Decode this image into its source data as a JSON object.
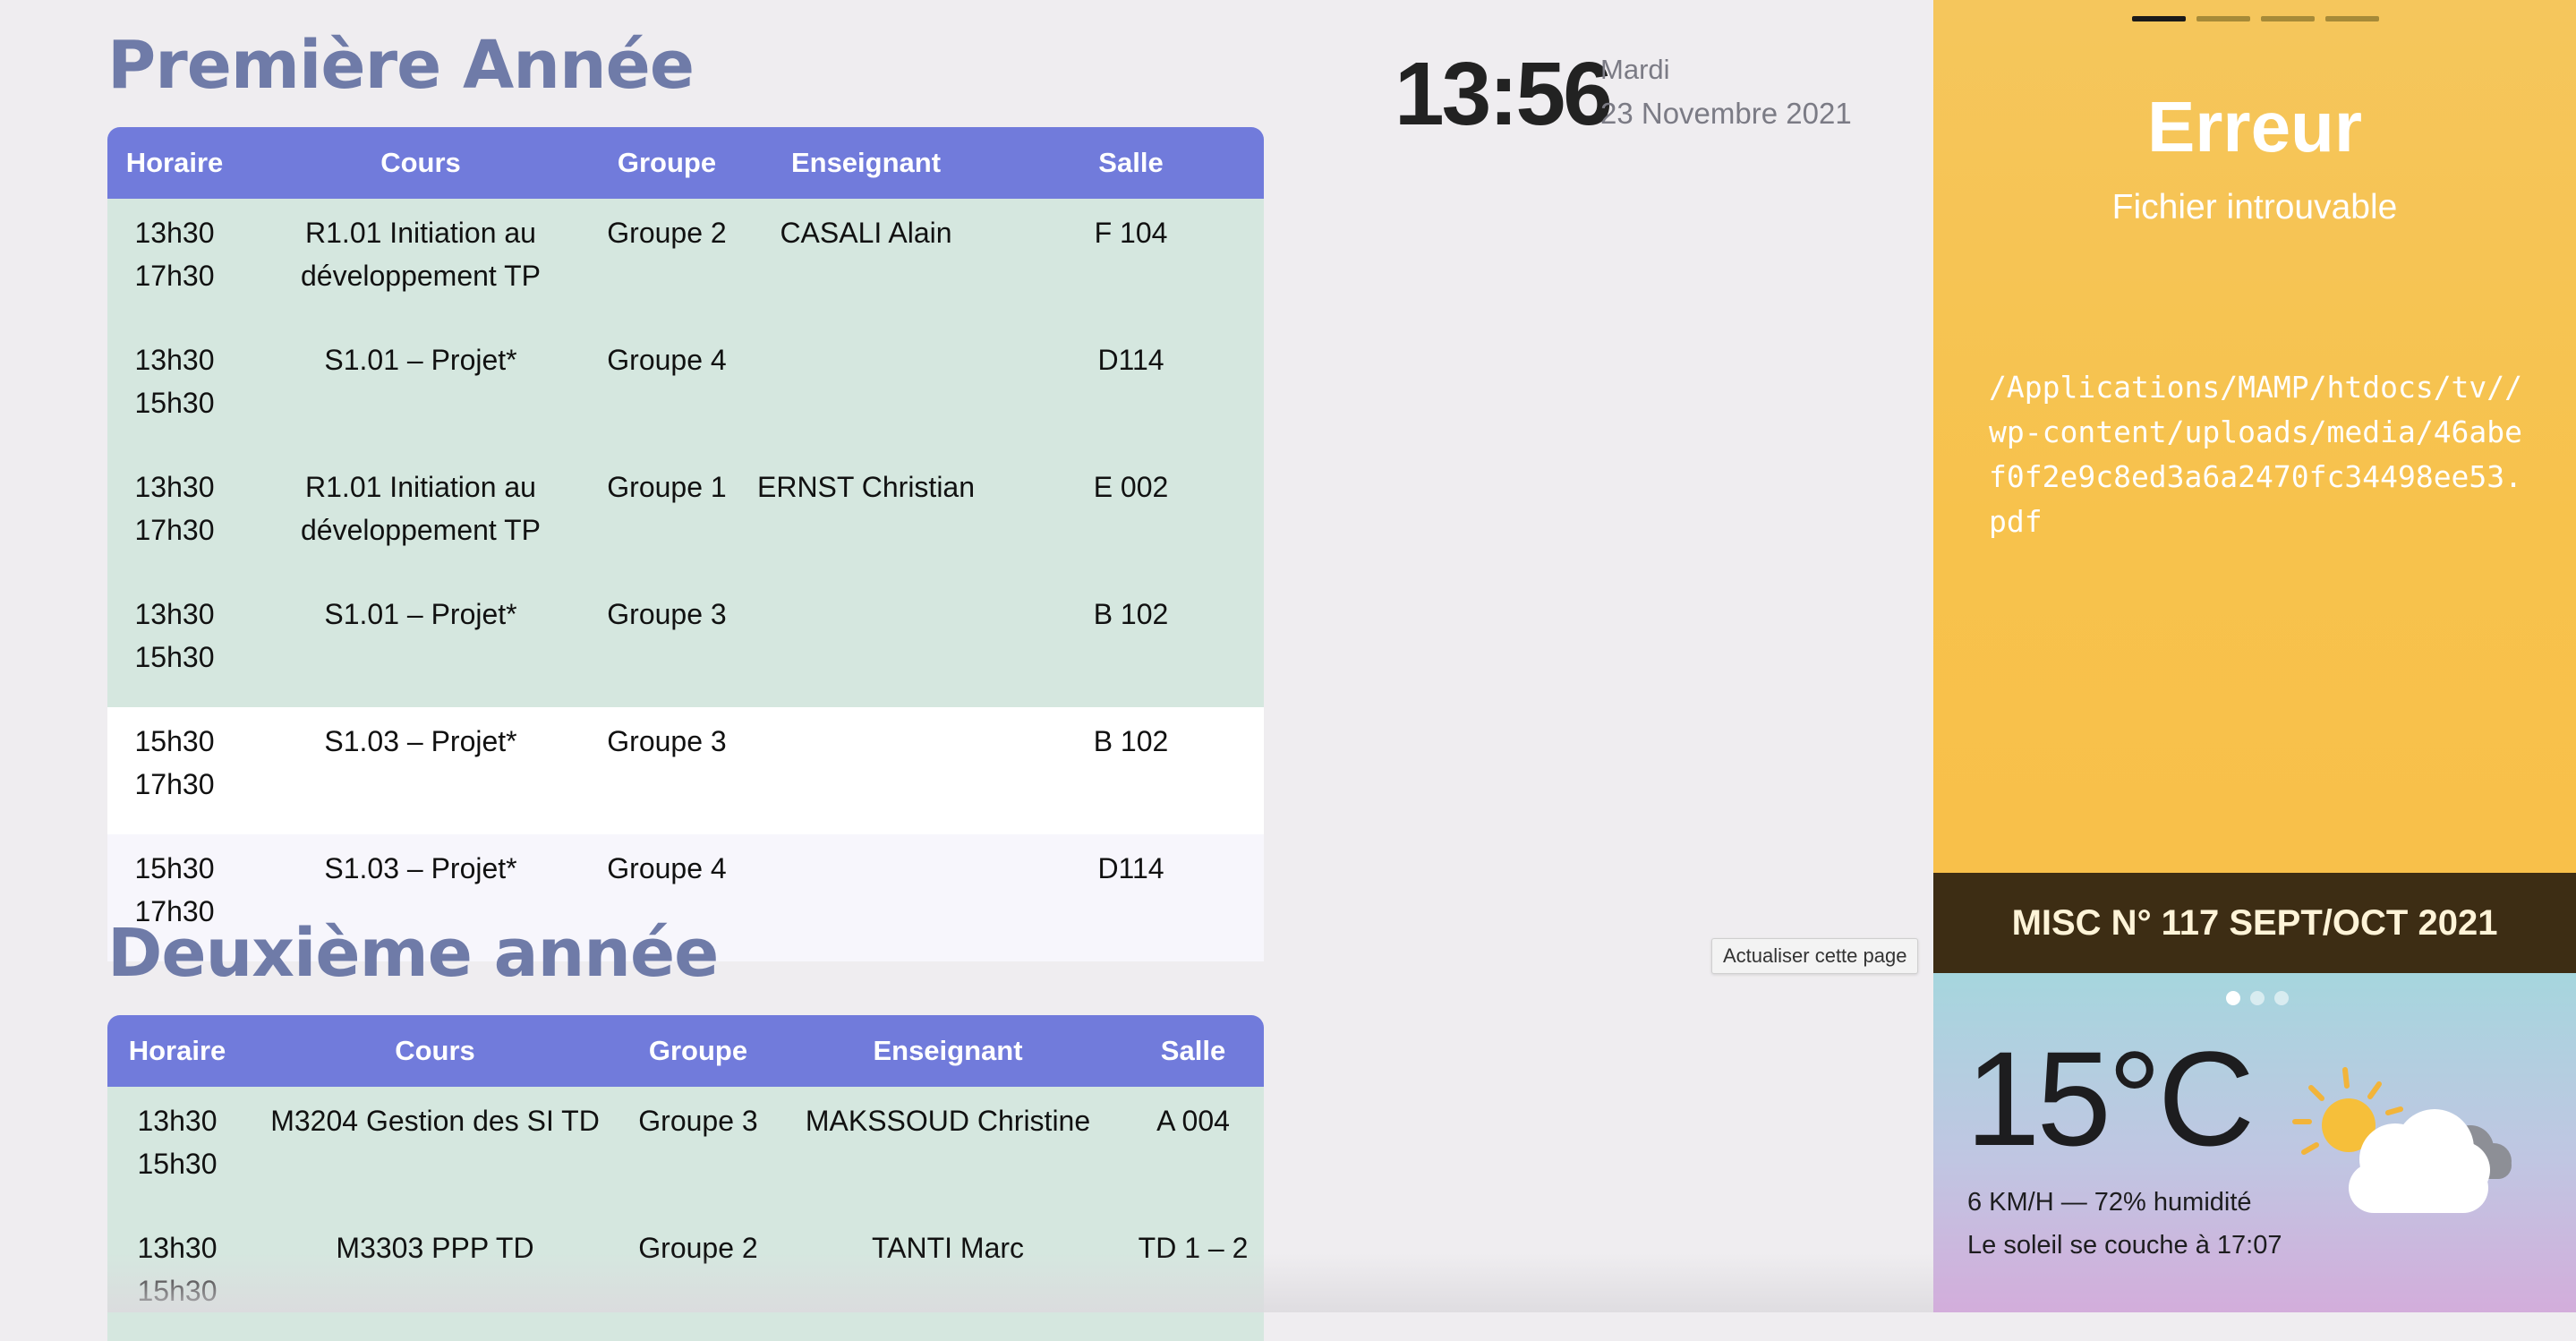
{
  "first_year": {
    "title": "Première Année",
    "headers": [
      "Horaire",
      "Cours",
      "Groupe",
      "Enseignant",
      "Salle"
    ],
    "rows": [
      {
        "start": "13h30",
        "end": "17h30",
        "course": "R1.01 Initiation au développement TP",
        "group": "Groupe 2",
        "teacher": "CASALI Alain",
        "room": "F 104"
      },
      {
        "start": "13h30",
        "end": "15h30",
        "course": "S1.01 – Projet*",
        "group": "Groupe 4",
        "teacher": "",
        "room": "D114"
      },
      {
        "start": "13h30",
        "end": "17h30",
        "course": "R1.01 Initiation au développement TP",
        "group": "Groupe 1",
        "teacher": "ERNST Christian",
        "room": "E 002"
      },
      {
        "start": "13h30",
        "end": "15h30",
        "course": "S1.01 – Projet*",
        "group": "Groupe 3",
        "teacher": "",
        "room": "B 102"
      },
      {
        "start": "15h30",
        "end": "17h30",
        "course": "S1.03 – Projet*",
        "group": "Groupe 3",
        "teacher": "",
        "room": "B 102"
      },
      {
        "start": "15h30",
        "end": "17h30",
        "course": "S1.03 – Projet*",
        "group": "Groupe 4",
        "teacher": "",
        "room": "D114"
      }
    ]
  },
  "second_year": {
    "title": "Deuxième année",
    "headers": [
      "Horaire",
      "Cours",
      "Groupe",
      "Enseignant",
      "Salle"
    ],
    "rows": [
      {
        "start": "13h30",
        "end": "15h30",
        "course": "M3204 Gestion des SI TD",
        "group": "Groupe 3",
        "teacher": "MAKSSOUD Christine",
        "room": "A 004"
      },
      {
        "start": "13h30",
        "end": "15h30",
        "course": "M3303 PPP TD",
        "group": "Groupe 2",
        "teacher": "TANTI Marc",
        "room": "TD 1 – 2"
      }
    ]
  },
  "clock": {
    "time": "13:56",
    "day": "Mardi",
    "date": "23 Novembre 2021"
  },
  "tooltip": "Actualiser cette page",
  "error_panel": {
    "title": "Erreur",
    "subtitle": "Fichier introuvable",
    "path": "/Applications/MAMP/htdocs/tv//wp-content/uploads/media/46abef0f2e9c8ed3a6a2470fc34498ee53.pdf",
    "slides_total": 4,
    "active_slide": 1
  },
  "banner": {
    "text": "MISC N° 117 SEPT/OCT 2021"
  },
  "weather": {
    "temperature": "15°C",
    "wind_humidity": "6 KM/H —  72% humidité",
    "sunset": "Le soleil se couche à 17:07",
    "icon": "partly-cloudy-icon",
    "pages_total": 3,
    "active_page": 1
  },
  "colors": {
    "header_blue": "#717bdb",
    "row_green": "#d5e7df",
    "title_slate": "#6f7ba8",
    "panel_yellow": "#f7c24c",
    "banner_brown": "#3d2d14"
  }
}
